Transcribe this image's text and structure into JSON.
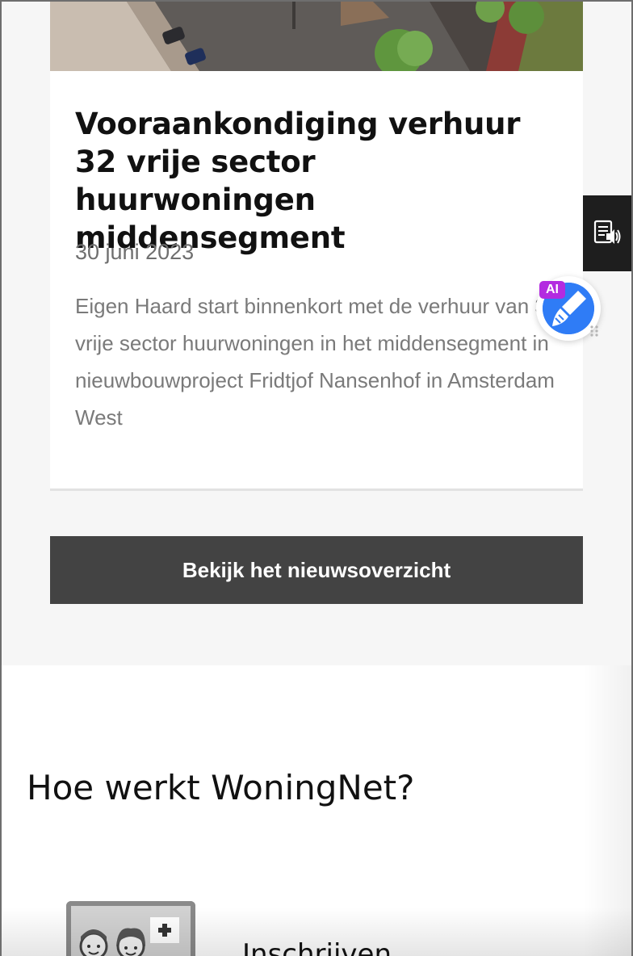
{
  "news": {
    "card": {
      "title": "Vooraankondiging verhuur 32 vrije sector huurwoningen middensegment",
      "date": "30 juni 2023",
      "excerpt": "Eigen Haard start binnenkort met de verhuur van 32 vrije sector huurwoningen in het middensegment in nieuwbouwproject Fridtjof Nansenhof in Amsterdam West"
    },
    "overview_button_label": "Bekijk het nieuwsoverzicht"
  },
  "how_it_works": {
    "title": "Hoe werkt WoningNet?",
    "steps": [
      {
        "label": "Inschrijven",
        "icon": "register-users-icon"
      }
    ]
  },
  "widgets": {
    "readspeaker_icon": "read-aloud-icon",
    "ai_badge": "AI",
    "ai_icon": "ai-assistant-brush-icon"
  },
  "colors": {
    "button_bg": "#434343",
    "ai_blue": "#2f7cf6",
    "ai_badge_purple": "#b32be0",
    "readspeaker_bg": "#1e1e1e"
  }
}
